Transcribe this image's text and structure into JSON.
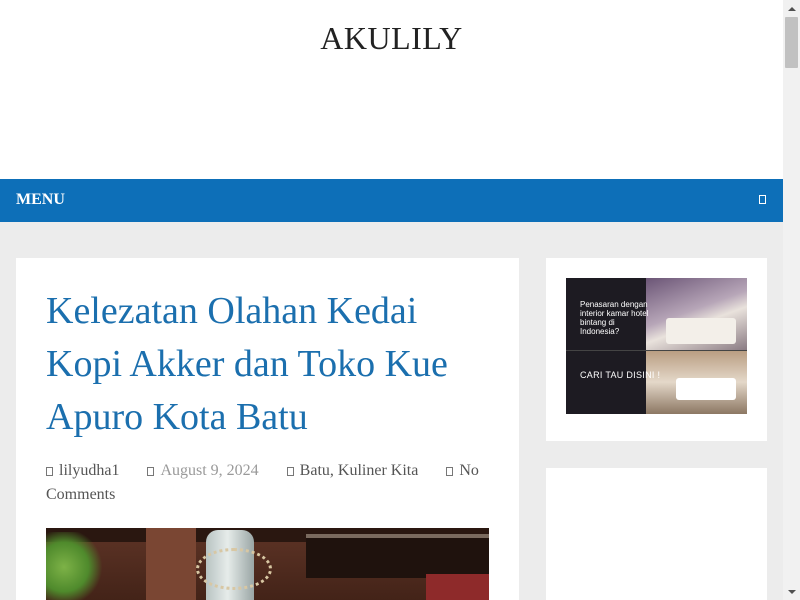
{
  "site": {
    "title": "AKULILY"
  },
  "nav": {
    "menu_label": "MENU",
    "toggle_icon": "menu-toggle-icon",
    "background": "#0d6fb8"
  },
  "post": {
    "title": "Kelezatan Olahan Kedai Kopi Akker dan Toko Kue Apuro Kota Batu",
    "author": "lilyudha1",
    "date": "August 9, 2024",
    "categories": "Batu, Kuliner Kita",
    "comments": "No Comments",
    "title_color": "#1b6fae"
  },
  "sidebar": {
    "ad": {
      "headline": "Penasaran dengan interior kamar hotel bintang di Indonesia?",
      "cta": "CARI TAU DISINI !"
    }
  },
  "colors": {
    "page_background": "#ececec",
    "accent": "#0d6fb8"
  }
}
